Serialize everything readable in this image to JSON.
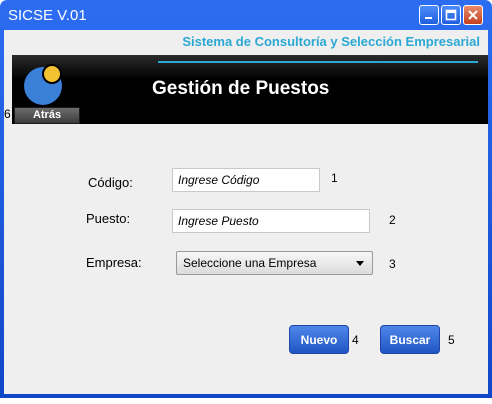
{
  "window": {
    "title": "SICSE V.01"
  },
  "header": {
    "subtitle": "Sistema de Consultoría y Selección Empresarial",
    "banner_title": "Gestión de Puestos",
    "back_label": "Atrás",
    "back_marker": "6"
  },
  "form": {
    "codigo": {
      "label": "Código:",
      "placeholder": "Ingrese Código",
      "marker": "1"
    },
    "puesto": {
      "label": "Puesto:",
      "placeholder": "Ingrese Puesto",
      "marker": "2"
    },
    "empresa": {
      "label": "Empresa:",
      "selected": "Seleccione una Empresa",
      "marker": "3"
    }
  },
  "actions": {
    "nuevo": {
      "label": "Nuevo",
      "marker": "4"
    },
    "buscar": {
      "label": "Buscar",
      "marker": "5"
    }
  },
  "colors": {
    "accent": "#2ba9d4",
    "titlebar": "#1f5fe0",
    "button": "#2f66d6",
    "logo_blue": "#3a7fd8",
    "logo_yellow": "#f2c230"
  },
  "icons": [
    "minimize-icon",
    "maximize-icon",
    "close-icon",
    "logo-icon",
    "chevron-down-icon"
  ]
}
